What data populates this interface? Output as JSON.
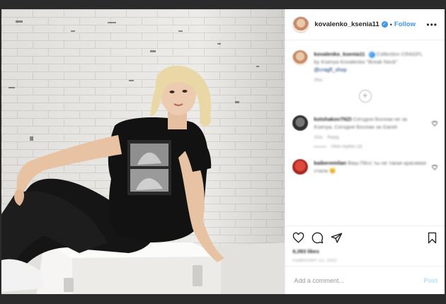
{
  "header": {
    "username": "kovalenko_ksenia11",
    "separator": "•",
    "follow_label": "Follow",
    "more_label": "•••"
  },
  "caption": {
    "username": "kovalenko_ksenia11",
    "text": "Collection CRAGFL",
    "text2": "by Ksenya Kovalenko \"Break Neck\"",
    "link": "@cragfl_shop",
    "time": "35w"
  },
  "comments": [
    {
      "username": "kotshakov7NZI",
      "text": "Сегодня Босеаи не за Ksenya, Сегодня Босеаи за Ganet",
      "time": "32w",
      "reply_label": "Reply",
      "view_replies": "View replies (3)"
    },
    {
      "username": "kaiberemilan",
      "text": "Ваш Пёсс ты не такая красивая стала 😊"
    }
  ],
  "post": {
    "likes": "6,393 likes",
    "date": "FEBRUARY 12, 2020"
  },
  "comment_box": {
    "placeholder": "Add a comment...",
    "post_label": "Post"
  },
  "colors": {
    "accent": "#3897f0",
    "post_disabled": "#b2dffc",
    "backdrop": "#2b2b2b"
  }
}
